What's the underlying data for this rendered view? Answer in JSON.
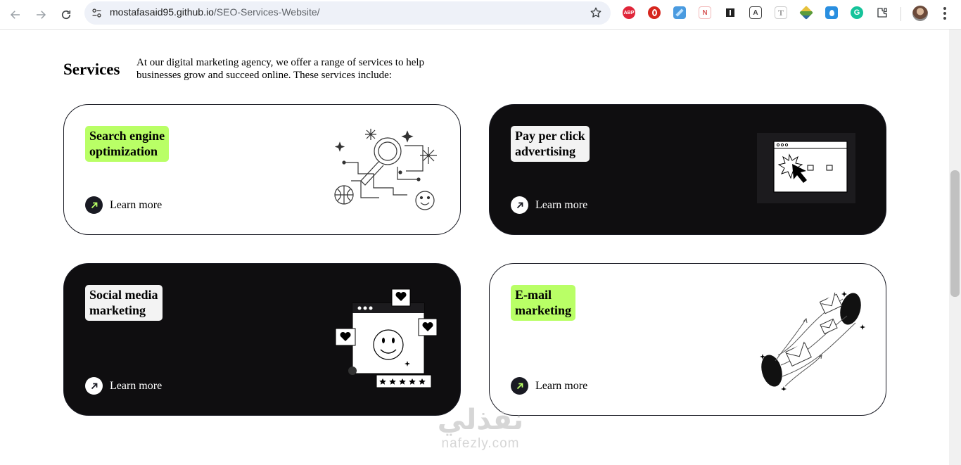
{
  "browser": {
    "url_host": "mostafasaid95.github.io",
    "url_path": "/SEO-Services-Website/",
    "extensions": [
      {
        "name": "adblock-plus-icon",
        "text": "ABP",
        "color": "#e0263a"
      },
      {
        "name": "opera-icon",
        "text": "",
        "color": "#d6261e"
      },
      {
        "name": "ruler-icon",
        "text": "",
        "color": "#4a9be0"
      },
      {
        "name": "n-extension-icon",
        "text": "N",
        "color": "#f2c9c9"
      },
      {
        "name": "qr-extension-icon",
        "text": "",
        "color": "#222222"
      },
      {
        "name": "a-extension-icon",
        "text": "A",
        "color": "#444444"
      },
      {
        "name": "t-extension-icon",
        "text": "T",
        "color": "#9a9a9a"
      },
      {
        "name": "box-extension-icon",
        "text": "",
        "color": "#5b9b3b"
      },
      {
        "name": "drop-extension-icon",
        "text": "",
        "color": "#2a8fe0"
      },
      {
        "name": "grammarly-icon",
        "text": "G",
        "color": "#15c39a"
      }
    ]
  },
  "services": {
    "title": "Services",
    "description": "At our digital marketing agency, we offer a range of services to help businesses grow and succeed online. These services include:",
    "learn_more": "Learn more",
    "cards": [
      {
        "title_line1": "Search engine",
        "title_line2": "optimization",
        "theme": "light",
        "badge": "green"
      },
      {
        "title_line1": "Pay per click",
        "title_line2": "advertising",
        "theme": "dark",
        "badge": "white"
      },
      {
        "title_line1": "Social media",
        "title_line2": "marketing",
        "theme": "dark",
        "badge": "white"
      },
      {
        "title_line1": "E-mail",
        "title_line2": "marketing",
        "theme": "light",
        "badge": "green"
      }
    ]
  },
  "watermark": {
    "arabic": "نفذلي",
    "latin": "nafezly.com"
  },
  "colors": {
    "accent_green": "#b9ff66",
    "dark": "#191a23",
    "badge_light": "#f3f3f3"
  }
}
